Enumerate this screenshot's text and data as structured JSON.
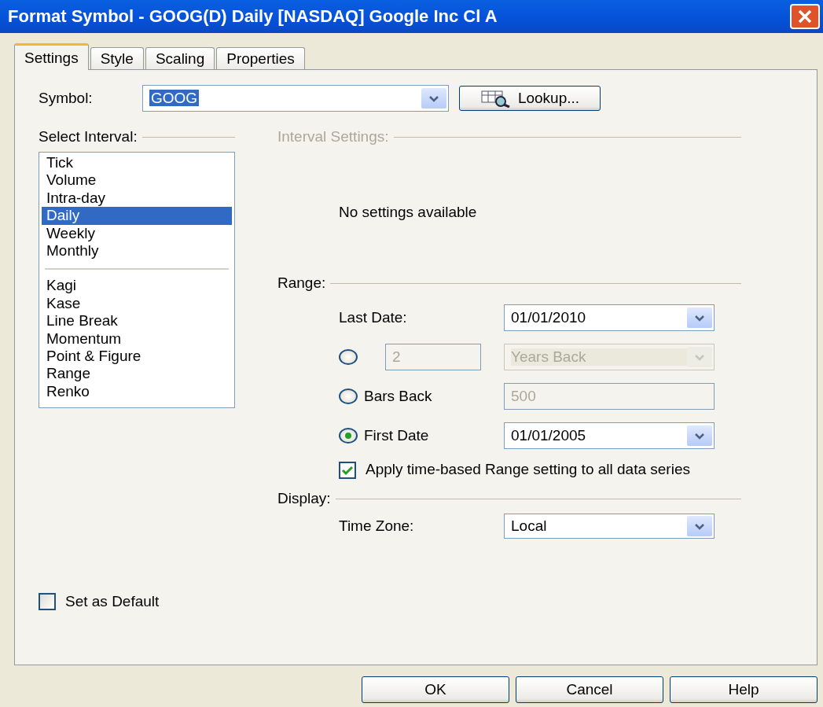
{
  "window": {
    "title": "Format Symbol - GOOG(D) Daily [NASDAQ] Google Inc Cl A"
  },
  "tabs": [
    {
      "label": "Settings",
      "selected": true
    },
    {
      "label": "Style",
      "selected": false
    },
    {
      "label": "Scaling",
      "selected": false
    },
    {
      "label": "Properties",
      "selected": false
    }
  ],
  "symbol": {
    "label": "Symbol:",
    "value": "GOOG",
    "lookup_button": "Lookup..."
  },
  "select_interval": {
    "heading": "Select Interval:",
    "groups": [
      {
        "items": [
          {
            "label": "Tick",
            "selected": false
          },
          {
            "label": "Volume",
            "selected": false
          },
          {
            "label": "Intra-day",
            "selected": false
          },
          {
            "label": "Daily",
            "selected": true
          },
          {
            "label": "Weekly",
            "selected": false
          },
          {
            "label": "Monthly",
            "selected": false
          }
        ]
      },
      {
        "items": [
          {
            "label": "Kagi",
            "selected": false
          },
          {
            "label": "Kase",
            "selected": false
          },
          {
            "label": "Line Break",
            "selected": false
          },
          {
            "label": "Momentum",
            "selected": false
          },
          {
            "label": "Point & Figure",
            "selected": false
          },
          {
            "label": "Range",
            "selected": false
          },
          {
            "label": "Renko",
            "selected": false
          }
        ]
      }
    ]
  },
  "interval_settings": {
    "heading": "Interval Settings:",
    "message": "No settings available"
  },
  "range": {
    "heading": "Range:",
    "last_date": {
      "label": "Last Date:",
      "value": "01/01/2010"
    },
    "options": [
      {
        "kind": "years",
        "selected": false,
        "value": "2",
        "unit": "Years Back",
        "disabled": true
      },
      {
        "kind": "bars",
        "selected": false,
        "label": "Bars Back",
        "value": "500",
        "disabled": true
      },
      {
        "kind": "date",
        "selected": true,
        "label": "First Date",
        "value": "01/01/2005",
        "disabled": false
      }
    ],
    "apply_all": {
      "label": "Apply time-based Range setting to all data series",
      "checked": true
    }
  },
  "display": {
    "heading": "Display:",
    "time_zone": {
      "label": "Time Zone:",
      "value": "Local"
    }
  },
  "set_as_default": {
    "label": "Set as Default",
    "checked": false
  },
  "buttons": [
    "OK",
    "Cancel",
    "Help"
  ]
}
